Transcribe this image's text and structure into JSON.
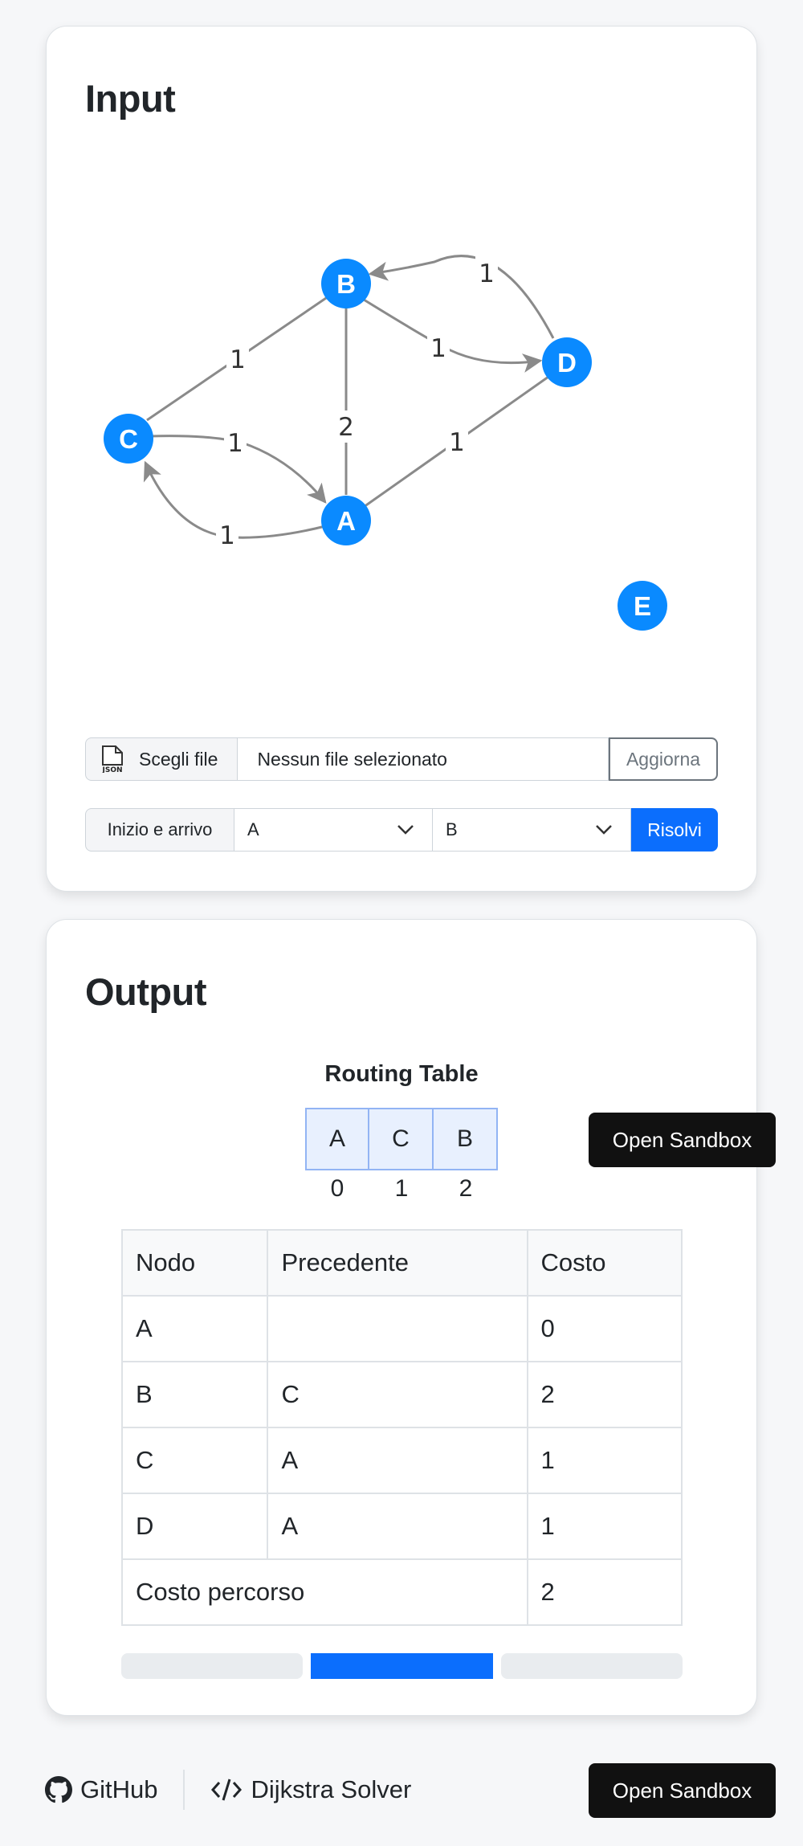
{
  "input": {
    "title": "Input",
    "graph": {
      "nodes": [
        "A",
        "B",
        "C",
        "D",
        "E"
      ],
      "edges": [
        {
          "from": "C",
          "to": "B",
          "weight": "1"
        },
        {
          "from": "A",
          "to": "B",
          "weight": "2"
        },
        {
          "from": "B",
          "to": "D",
          "weight": "1"
        },
        {
          "from": "D",
          "to": "B",
          "weight": "1"
        },
        {
          "from": "A",
          "to": "D",
          "weight": "1"
        },
        {
          "from": "C",
          "to": "A",
          "weight": "1"
        },
        {
          "from": "A",
          "to": "C",
          "weight": "1"
        }
      ]
    },
    "file": {
      "button_label": "Scegli file",
      "file_icon_text": "JSON",
      "file_name": "Nessun file selezionato",
      "update_label": "Aggiorna"
    },
    "route": {
      "label": "Inizio e arrivo",
      "start": "A",
      "end": "B",
      "solve_label": "Risolvi"
    }
  },
  "output": {
    "title": "Output",
    "routing_table": {
      "title": "Routing Table",
      "cells": [
        {
          "node": "A",
          "index": "0"
        },
        {
          "node": "C",
          "index": "1"
        },
        {
          "node": "B",
          "index": "2"
        }
      ]
    },
    "table": {
      "headers": [
        "Nodo",
        "Precedente",
        "Costo"
      ],
      "rows": [
        [
          "A",
          "",
          "0"
        ],
        [
          "B",
          "C",
          "2"
        ],
        [
          "C",
          "A",
          "1"
        ],
        [
          "D",
          "A",
          "1"
        ]
      ],
      "total_label": "Costo percorso",
      "total_value": "2"
    },
    "progress": {
      "segments": 3,
      "active_segment": 2
    }
  },
  "sandbox_label": "Open Sandbox",
  "footer": {
    "github_label": "GitHub",
    "app_label": "Dijkstra Solver"
  },
  "colors": {
    "node": "#0a8aff",
    "primary": "#0b6efd",
    "edge": "#8a8a8a"
  }
}
